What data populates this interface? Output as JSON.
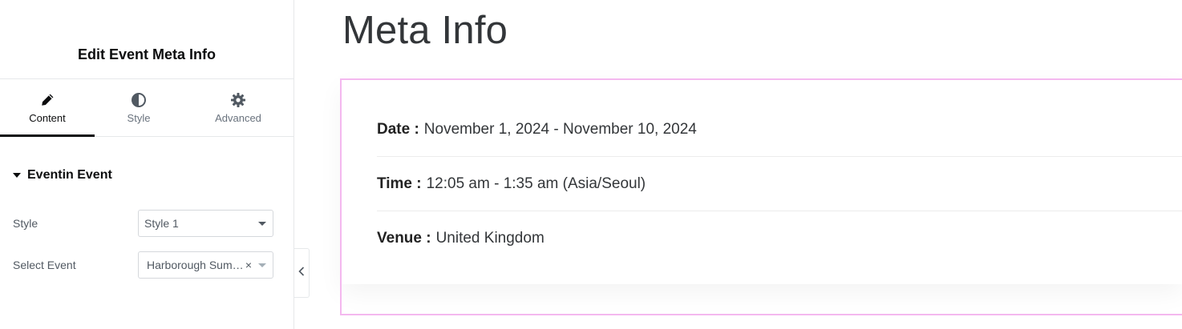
{
  "panel": {
    "title": "Edit Event Meta Info",
    "tabs": [
      {
        "label": "Content",
        "icon": "pencil-icon",
        "active": true
      },
      {
        "label": "Style",
        "icon": "half-circle-icon",
        "active": false
      },
      {
        "label": "Advanced",
        "icon": "gear-icon",
        "active": false
      }
    ],
    "section": {
      "title": "Eventin Event",
      "icon": "caret-down-icon"
    },
    "controls": {
      "style": {
        "label": "Style",
        "value": "Style 1"
      },
      "event": {
        "label": "Select Event",
        "value": "Harborough Sum…",
        "clear": "×"
      }
    }
  },
  "preview": {
    "title": "Meta Info",
    "meta": [
      {
        "key": "Date :",
        "value": "November 1, 2024 - November 10, 2024"
      },
      {
        "key": "Time :",
        "value": "12:05 am - 1:35 am (Asia/Seoul)"
      },
      {
        "key": "Venue :",
        "value": "United Kingdom"
      }
    ]
  },
  "colors": {
    "accent": "#0c0d0e",
    "selection_outline": "#f4b8ef",
    "muted_text": "#69727d"
  }
}
